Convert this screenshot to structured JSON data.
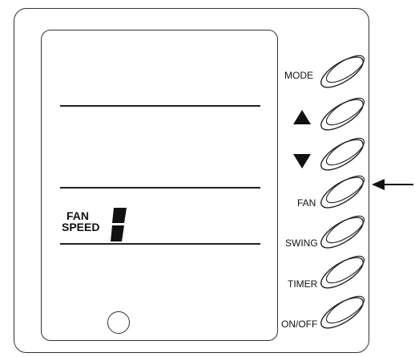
{
  "display": {
    "fan_speed_label_line1": "FAN",
    "fan_speed_label_line2": "SPEED"
  },
  "buttons": {
    "mode": "MODE",
    "fan": "FAN",
    "swing": "SWING",
    "timer": "TIMER",
    "on_off": "ON/OFF"
  },
  "icons": {
    "up": "triangle-up-icon",
    "down": "triangle-down-icon",
    "indicator": "arrow-left-icon"
  }
}
